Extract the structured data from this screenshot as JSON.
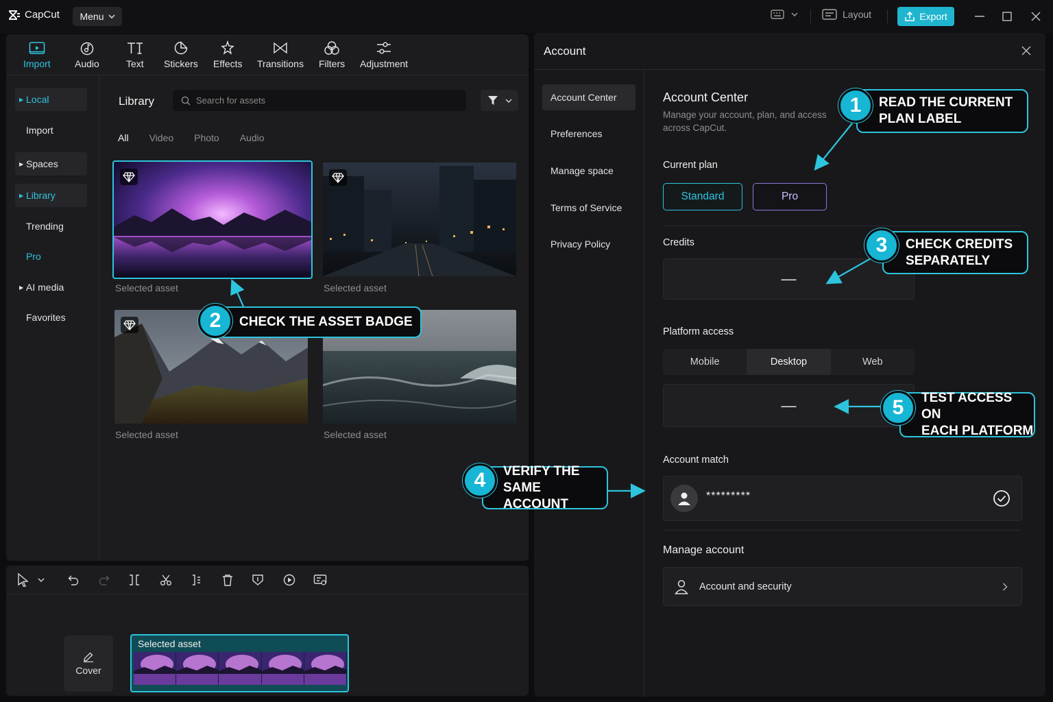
{
  "app": {
    "name": "CapCut",
    "menu_label": "Menu",
    "layout_label": "Layout",
    "export_label": "Export"
  },
  "toolbar": [
    {
      "label": "Import",
      "icon": "import-icon",
      "active": true
    },
    {
      "label": "Audio",
      "icon": "audio-icon"
    },
    {
      "label": "Text",
      "icon": "text-icon"
    },
    {
      "label": "Stickers",
      "icon": "stickers-icon"
    },
    {
      "label": "Effects",
      "icon": "effects-icon"
    },
    {
      "label": "Transitions",
      "icon": "transitions-icon"
    },
    {
      "label": "Filters",
      "icon": "filters-icon"
    },
    {
      "label": "Adjustment",
      "icon": "adjustment-icon"
    }
  ],
  "sidenav": [
    {
      "label": "Local"
    },
    {
      "label": "Import"
    },
    {
      "label": "Spaces"
    },
    {
      "label": "Library"
    },
    {
      "label": "Trending"
    },
    {
      "label": "Pro"
    },
    {
      "label": "AI media"
    },
    {
      "label": "Favorites"
    }
  ],
  "library": {
    "title": "Library",
    "search_placeholder": "Search for assets",
    "tabs": [
      "All",
      "Video",
      "Photo",
      "Audio"
    ],
    "assets": [
      {
        "caption": "Selected asset",
        "scene": "aurora-lake",
        "badge": "diamond-icon"
      },
      {
        "caption": "Selected asset",
        "scene": "night-city",
        "badge": "diamond-icon"
      },
      {
        "caption": "Selected asset",
        "scene": "mountain-valley",
        "badge": "diamond-icon"
      },
      {
        "caption": "Selected asset",
        "scene": "ocean-waves"
      }
    ]
  },
  "timeline": {
    "cover_label": "Cover",
    "clip_label": "Selected asset"
  },
  "account": {
    "title": "Account",
    "nav": [
      "Account Center",
      "Preferences",
      "Manage space",
      "Terms of Service",
      "Privacy Policy"
    ],
    "heading": "Account Center",
    "subtitle": "Manage your account, plan, and access across CapCut.",
    "current_plan_label": "Current plan",
    "plans": [
      "Standard",
      "Pro"
    ],
    "credits_label": "Credits",
    "credits_value": "—",
    "platform_label": "Platform access",
    "platforms": [
      "Mobile",
      "Desktop",
      "Web"
    ],
    "selected_platform": "Desktop",
    "platform_value": "—",
    "match_label": "Account match",
    "masked_account": "*********",
    "manage_label": "Manage account",
    "security_label": "Account and security"
  },
  "callouts": [
    {
      "num": "1",
      "line1": "READ THE CURRENT",
      "line2": "PLAN LABEL"
    },
    {
      "num": "2",
      "line1": "CHECK THE ASSET BADGE",
      "line2": ""
    },
    {
      "num": "3",
      "line1": "CHECK CREDITS",
      "line2": "SEPARATELY"
    },
    {
      "num": "4",
      "line1": "VERIFY THE",
      "line2": "SAME ACCOUNT"
    },
    {
      "num": "5",
      "line1": "TEST ACCESS ON",
      "line2": "EACH PLATFORM"
    }
  ],
  "colors": {
    "accent": "#2ec4dd",
    "pro": "#8a7ad8",
    "background": "#0d0d0f"
  }
}
